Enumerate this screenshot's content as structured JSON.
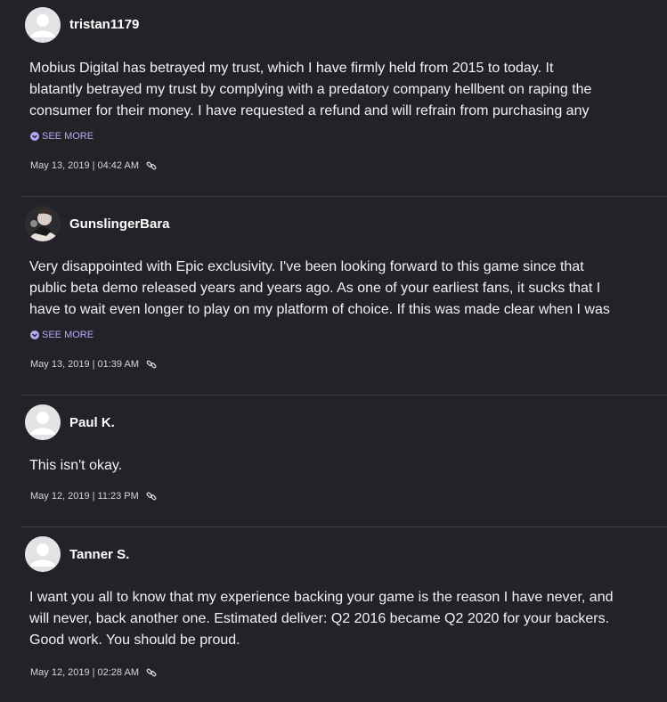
{
  "comments": [
    {
      "username": "tristan1179",
      "avatar": "default-avatar-icon",
      "lines": [
        "Mobius Digital has betrayed my trust, which I have firmly held from 2015 to today. It",
        "blatantly betrayed my trust by complying with a predatory company hellbent on raping the",
        "consumer for their money. I have requested a refund and will refrain from purchasing any"
      ],
      "see_more": "SEE MORE",
      "date": "May 13, 2019",
      "separator": "|",
      "time": "04:42 AM"
    },
    {
      "username": "GunslingerBara",
      "avatar": "user-photo-avatar",
      "lines": [
        "Very disappointed with Epic exclusivity. I've been looking forward to this game since that",
        "public beta demo released years and years ago. As one of your earliest fans, it sucks that I",
        "have to wait even longer to play on my platform of choice. If this was made clear when I was"
      ],
      "see_more": "SEE MORE",
      "date": "May 13, 2019",
      "separator": "|",
      "time": "01:39 AM"
    },
    {
      "username": "Paul K.",
      "avatar": "default-avatar-icon",
      "lines": [
        "This isn't okay."
      ],
      "see_more": "",
      "date": "May 12, 2019",
      "separator": "|",
      "time": "11:23 PM"
    },
    {
      "username": "Tanner S.",
      "avatar": "default-avatar-icon",
      "lines": [
        "I want you all to know that my experience backing your game is the reason I have never, and",
        "will never, back another one. Estimated deliver: Q2 2016 became Q2 2020 for your backers.",
        "Good work. You should be proud."
      ],
      "see_more": "",
      "date": "May 12, 2019",
      "separator": "|",
      "time": "02:28 AM"
    }
  ],
  "colors": {
    "background": "#232228",
    "divider": "#3e3d45",
    "see_more_accent": "#b7a8f4",
    "text": "#f2f2f4"
  }
}
